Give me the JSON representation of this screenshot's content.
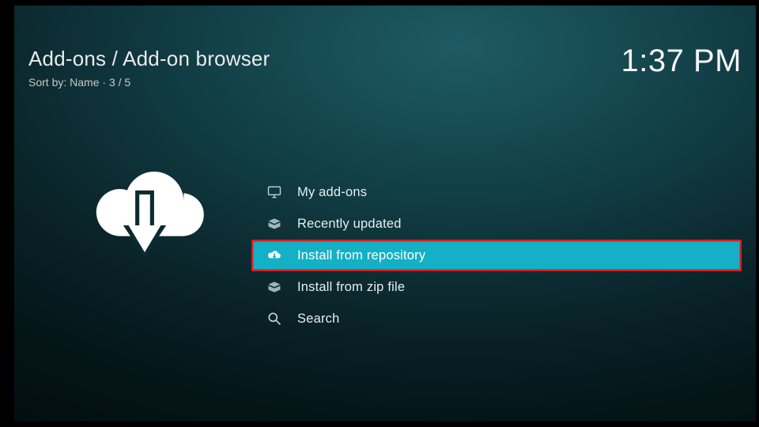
{
  "header": {
    "breadcrumb": "Add-ons / Add-on browser",
    "sort_label": "Sort by: Name",
    "position": "3 / 5",
    "clock": "1:37 PM"
  },
  "sidebar": {
    "icon": "cloud-download-icon"
  },
  "menu": {
    "selected_index": 2,
    "items": [
      {
        "icon": "screen-icon",
        "label": "My add-ons"
      },
      {
        "icon": "open-box-icon",
        "label": "Recently updated"
      },
      {
        "icon": "cloud-download-icon",
        "label": "Install from repository"
      },
      {
        "icon": "open-box-icon",
        "label": "Install from zip file"
      },
      {
        "icon": "search-icon",
        "label": "Search"
      }
    ]
  }
}
